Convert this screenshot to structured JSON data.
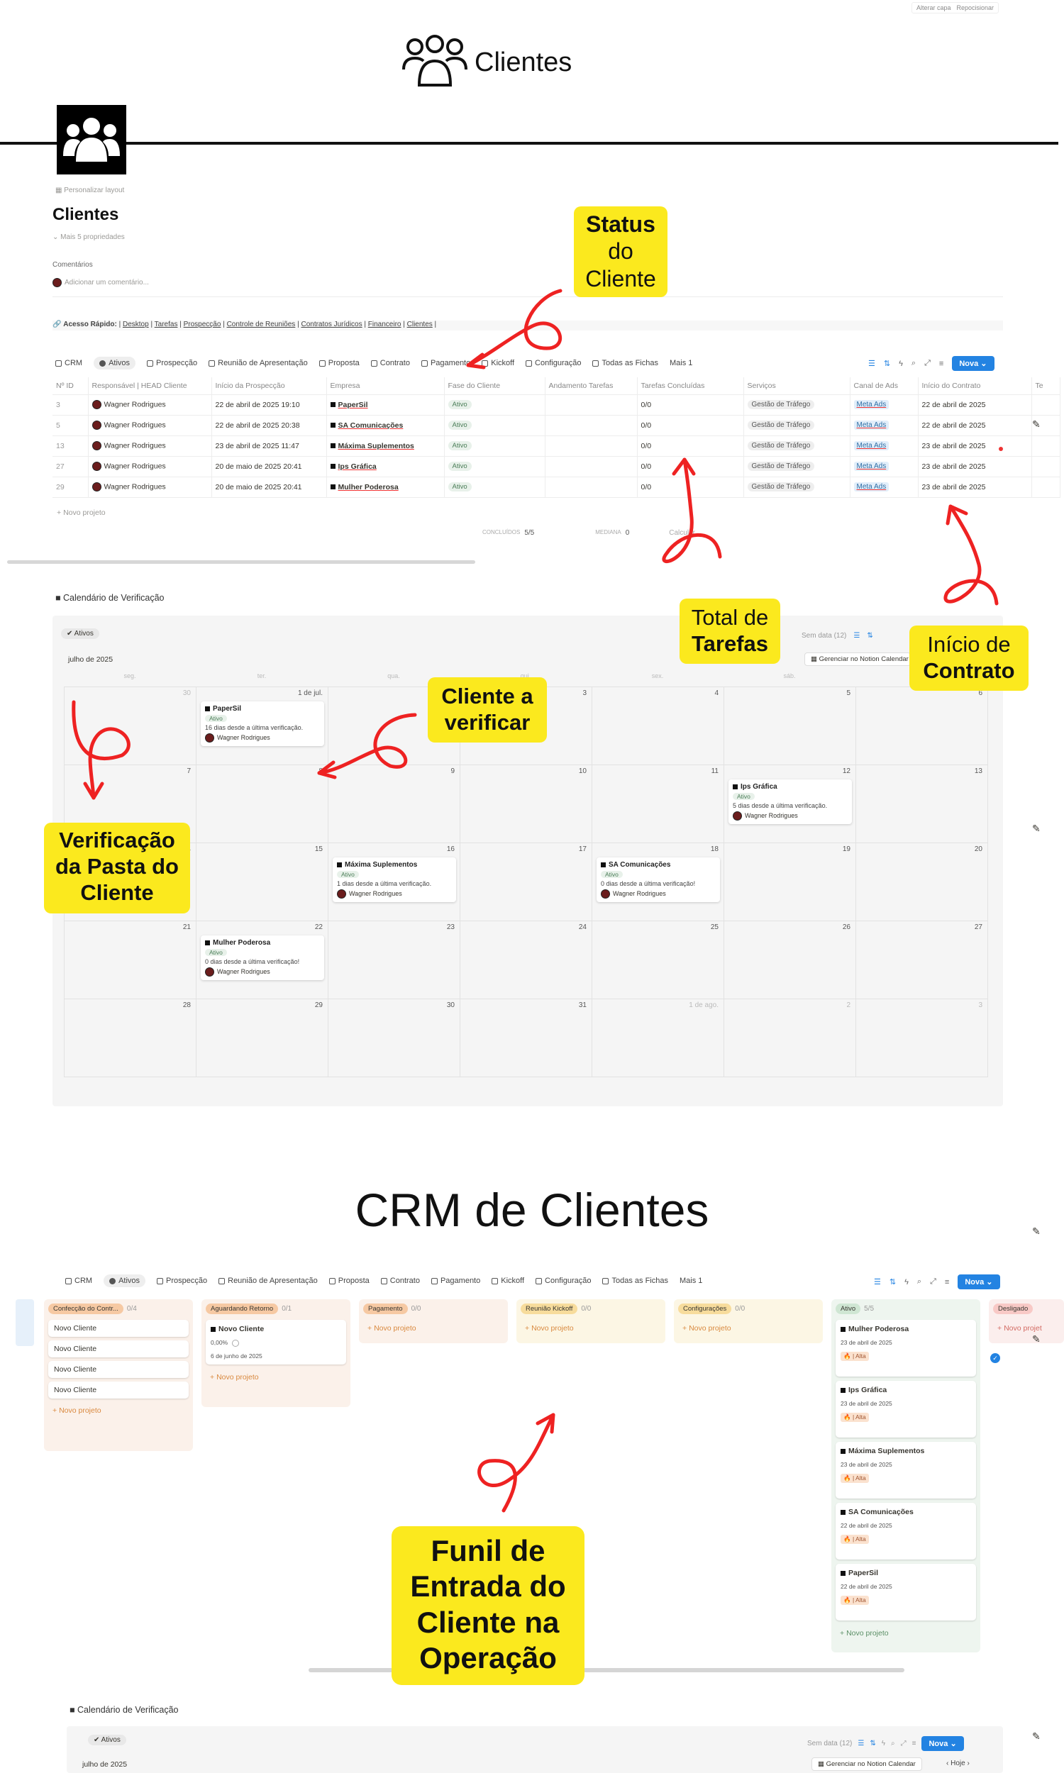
{
  "top_buttons": {
    "change_cover": "Alterar capa",
    "reposition": "Repocisionar"
  },
  "hero": {
    "title": "Clientes"
  },
  "page": {
    "customize_layout": "Personalizar layout",
    "title": "Clientes",
    "more_props": "Mais 5 propriedades",
    "comments_label": "Comentários",
    "comment_placeholder": "Adicionar um comentário...",
    "quick_access_label": "Acesso Rápido:",
    "quick_links": [
      "Desktop",
      "Tarefas",
      "Prospecção",
      "Controle de Reuniões",
      "Contratos Jurídicos",
      "Financeiro",
      "Clientes"
    ]
  },
  "tabs1": [
    "CRM",
    "Ativos",
    "Prospecção",
    "Reunião de Apresentação",
    "Proposta",
    "Contrato",
    "Pagamento",
    "Kickoff",
    "Configuração",
    "Todas as Fichas",
    "Mais 1"
  ],
  "new_button": "Nova",
  "table": {
    "headers": [
      "Nº ID",
      "Responsável | HEAD Cliente",
      "Início da Prospecção",
      "Empresa",
      "Fase do Cliente",
      "Andamento Tarefas",
      "Tarefas Concluídas",
      "Serviços",
      "Canal de Ads",
      "Início do Contrato",
      "Te"
    ],
    "rows": [
      {
        "id": "3",
        "resp": "Wagner Rodrigues",
        "inicio": "22 de abril de 2025 19:10",
        "empresa": "PaperSil",
        "fase": "Ativo",
        "tarefas": "0/0",
        "servico": "Gestão de Tráfego",
        "canal": "Meta Ads",
        "contrato": "22 de abril de 2025"
      },
      {
        "id": "5",
        "resp": "Wagner Rodrigues",
        "inicio": "22 de abril de 2025 20:38",
        "empresa": "SA Comunicações",
        "fase": "Ativo",
        "tarefas": "0/0",
        "servico": "Gestão de Tráfego",
        "canal": "Meta Ads",
        "contrato": "22 de abril de 2025"
      },
      {
        "id": "13",
        "resp": "Wagner Rodrigues",
        "inicio": "23 de abril de 2025 11:47",
        "empresa": "Máxima Suplementos",
        "fase": "Ativo",
        "tarefas": "0/0",
        "servico": "Gestão de Tráfego",
        "canal": "Meta Ads",
        "contrato": "23 de abril de 2025"
      },
      {
        "id": "27",
        "resp": "Wagner Rodrigues",
        "inicio": "20 de maio de 2025 20:41",
        "empresa": "Ips Gráfica",
        "fase": "Ativo",
        "tarefas": "0/0",
        "servico": "Gestão de Tráfego",
        "canal": "Meta Ads",
        "contrato": "23 de abril de 2025"
      },
      {
        "id": "29",
        "resp": "Wagner Rodrigues",
        "inicio": "20 de maio de 2025 20:41",
        "empresa": "Mulher Poderosa",
        "fase": "Ativo",
        "tarefas": "0/0",
        "servico": "Gestão de Tráfego",
        "canal": "Meta Ads",
        "contrato": "23 de abril de 2025"
      }
    ],
    "new_project": "Novo projeto",
    "footer_done_label": "CONCLUÍDOS",
    "footer_done_value": "5/5",
    "footer_median_label": "MEDIANA",
    "footer_median_value": "0",
    "footer_calc": "Calcular"
  },
  "annotations": {
    "status": [
      "Status",
      "do",
      "Cliente"
    ],
    "total": [
      "Total de",
      "Tarefas"
    ],
    "inicio": [
      "Início de",
      "Contrato"
    ],
    "verificar": [
      "Cliente a",
      "verificar"
    ],
    "pasta": [
      "Verificação",
      "da Pasta do",
      "Cliente"
    ],
    "funil": [
      "Funil de",
      "Entrada do",
      "Cliente na",
      "Operação"
    ]
  },
  "calendar": {
    "section_title": "Calendário de Verificação",
    "filter": "Ativos",
    "month": "julho de 2025",
    "no_date": "Sem data (12)",
    "manage": "Gerenciar no Notion Calendar",
    "weekdays": [
      "seg.",
      "ter.",
      "qua.",
      "qui.",
      "sex.",
      "sáb.",
      "dom."
    ],
    "days": [
      "30",
      "1 de jul.",
      "2",
      "3",
      "4",
      "5",
      "6",
      "7",
      "8",
      "9",
      "10",
      "11",
      "12",
      "13",
      "14",
      "15",
      "16",
      "17",
      "18",
      "19",
      "20",
      "21",
      "22",
      "23",
      "24",
      "25",
      "26",
      "27",
      "28",
      "29",
      "30",
      "31",
      "1 de ago.",
      "2",
      "3"
    ],
    "events": [
      {
        "day_index": 1,
        "name": "PaperSil",
        "status": "Ativo",
        "desc": "16 dias desde a última verificação.",
        "owner": "Wagner Rodrigues"
      },
      {
        "day_index": 12,
        "name": "Ips Gráfica",
        "status": "Ativo",
        "desc": "5 dias desde a última verificação.",
        "owner": "Wagner Rodrigues"
      },
      {
        "day_index": 16,
        "name": "Máxima Suplementos",
        "status": "Ativo",
        "desc": "1 dias desde a última verificação.",
        "owner": "Wagner Rodrigues"
      },
      {
        "day_index": 18,
        "name": "SA Comunicações",
        "status": "Ativo",
        "desc": "0 dias desde a última verificação!",
        "owner": "Wagner Rodrigues"
      },
      {
        "day_index": 22,
        "name": "Mulher Poderosa",
        "status": "Ativo",
        "desc": "0 dias desde a última verificação!",
        "owner": "Wagner Rodrigues"
      }
    ]
  },
  "crm_title": "CRM de Clientes",
  "tabs2": [
    "CRM",
    "Ativos",
    "Prospecção",
    "Reunião de Apresentação",
    "Proposta",
    "Contrato",
    "Pagamento",
    "Kickoff",
    "Configuração",
    "Todas as Fichas",
    "Mais 1"
  ],
  "kanban": [
    {
      "name": "Confecção do Contr...",
      "count": "0/4",
      "color": "#f6c9a3",
      "bg": "#fbf1ea",
      "cards": [
        {
          "title": "Novo Cliente"
        },
        {
          "title": "Novo Cliente"
        },
        {
          "title": "Novo Cliente"
        },
        {
          "title": "Novo Cliente"
        }
      ]
    },
    {
      "name": "Aguardando Retorno",
      "count": "0/1",
      "color": "#f6c9a3",
      "bg": "#fbf1ea",
      "cards": [
        {
          "title": "Novo Cliente",
          "pct": "0,00%",
          "date": "6 de junho de 2025"
        }
      ]
    },
    {
      "name": "Pagamento",
      "count": "0/0",
      "color": "#f6c9a3",
      "bg": "#fbf1ea",
      "cards": []
    },
    {
      "name": "Reunião Kickoff",
      "count": "0/0",
      "color": "#f7dc9c",
      "bg": "#fcf6e4",
      "cards": []
    },
    {
      "name": "Configurações",
      "count": "0/0",
      "color": "#f7dc9c",
      "bg": "#fcf6e4",
      "cards": []
    },
    {
      "name": "Ativo",
      "count": "5/5",
      "color": "#cfe6d3",
      "bg": "#eef5ef",
      "cards": [
        {
          "title": "Mulher Poderosa",
          "date": "23 de abril de 2025",
          "tag": "| Alta"
        },
        {
          "title": "Ips Gráfica",
          "date": "23 de abril de 2025",
          "tag": "| Alta"
        },
        {
          "title": "Máxima Suplementos",
          "date": "23 de abril de 2025",
          "tag": "| Alta"
        },
        {
          "title": "SA Comunicações",
          "date": "22 de abril de 2025",
          "tag": "| Alta"
        },
        {
          "title": "PaperSil",
          "date": "22 de abril de 2025",
          "tag": "| Alta"
        }
      ]
    },
    {
      "name": "Desligado",
      "count": "",
      "color": "#f8c9c6",
      "bg": "#fbeeed",
      "cards": []
    }
  ],
  "kanban_new": "Novo projeto",
  "kanban_new_short": "Novo projet",
  "cal2": {
    "section_title": "Calendário de Verificação",
    "filter": "Ativos",
    "month": "julho de 2025",
    "no_date": "Sem data (12)",
    "manage": "Gerenciar no Notion Calendar",
    "today": "Hoje"
  }
}
